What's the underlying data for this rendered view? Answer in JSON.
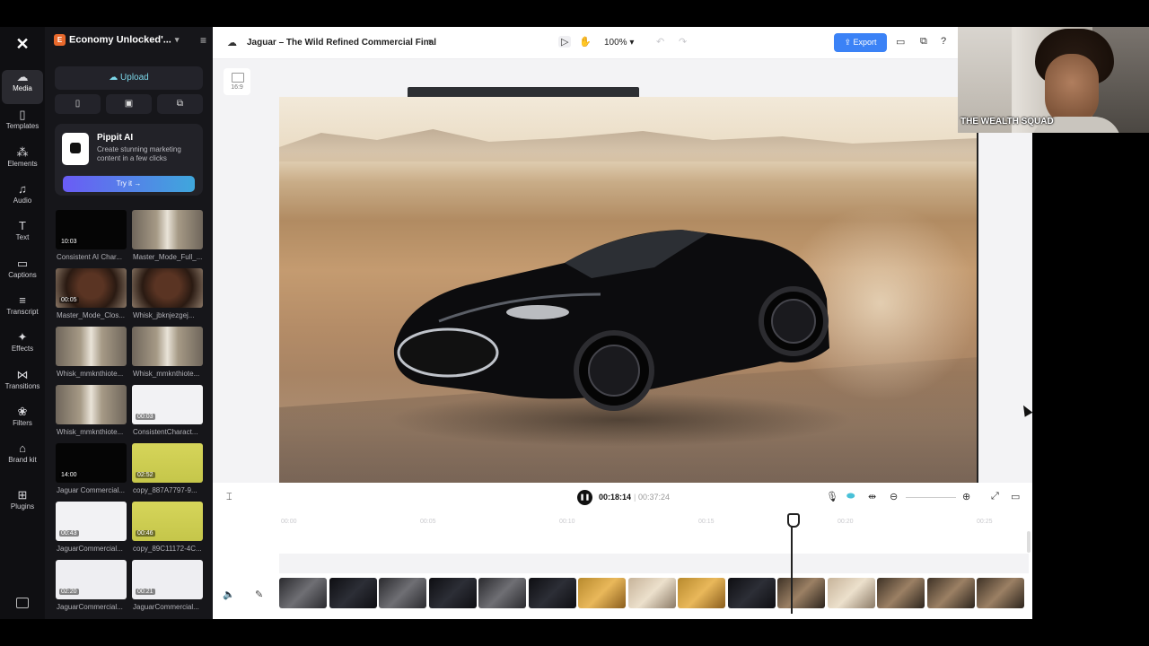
{
  "rail": {
    "items": [
      {
        "label": "Media",
        "icon": "media-icon",
        "glyph": "☁"
      },
      {
        "label": "Templates",
        "icon": "templates-icon",
        "glyph": "▯"
      },
      {
        "label": "Elements",
        "icon": "elements-icon",
        "glyph": "⁂"
      },
      {
        "label": "Audio",
        "icon": "audio-icon",
        "glyph": "♫"
      },
      {
        "label": "Text",
        "icon": "text-icon",
        "glyph": "T"
      },
      {
        "label": "Captions",
        "icon": "captions-icon",
        "glyph": "▭"
      },
      {
        "label": "Transcript",
        "icon": "transcript-icon",
        "glyph": "≡"
      },
      {
        "label": "Effects",
        "icon": "effects-icon",
        "glyph": "✦"
      },
      {
        "label": "Transitions",
        "icon": "transitions-icon",
        "glyph": "⋈"
      },
      {
        "label": "Filters",
        "icon": "filters-icon",
        "glyph": "❀"
      },
      {
        "label": "Brand kit",
        "icon": "brand-kit-icon",
        "glyph": "⌂"
      },
      {
        "label": "Plugins",
        "icon": "plugins-icon",
        "glyph": "⊞"
      }
    ]
  },
  "panel": {
    "project_badge": "E",
    "project_name": "Economy Unlocked'...",
    "upload_label": "Upload",
    "promo": {
      "title": "Pippit AI",
      "text": "Create stunning marketing content in a few clicks",
      "button": "Try it →"
    },
    "media": [
      {
        "caption": "Consistent AI Char...",
        "duration": "10:03",
        "style": "t-black"
      },
      {
        "caption": "Master_Mode_Full_...",
        "duration": "",
        "style": "t-girl"
      },
      {
        "caption": "Master_Mode_Clos...",
        "duration": "00:05",
        "style": "t-face"
      },
      {
        "caption": "Whisk_jbknjezgej...",
        "duration": "",
        "style": "t-face"
      },
      {
        "caption": "Whisk_mmknthiote...",
        "duration": "",
        "style": "t-girl"
      },
      {
        "caption": "Whisk_mmknthiote...",
        "duration": "",
        "style": "t-girl"
      },
      {
        "caption": "Whisk_mmknthiote...",
        "duration": "",
        "style": "t-girl"
      },
      {
        "caption": "ConsistentCharact...",
        "duration": "00:03",
        "style": "t-white"
      },
      {
        "caption": "Jaguar Commercial...",
        "duration": "14:00",
        "style": "t-black"
      },
      {
        "caption": "copy_887A7797-9...",
        "duration": "02:52",
        "style": "t-yellow"
      },
      {
        "caption": "JaguarCommercial...",
        "duration": "00:43",
        "style": "t-white"
      },
      {
        "caption": "copy_89C11172-4C...",
        "duration": "00:46",
        "style": "t-yellow"
      },
      {
        "caption": "JaguarCommercial...",
        "duration": "02:20",
        "style": "t-doc"
      },
      {
        "caption": "JaguarCommercial...",
        "duration": "00:21",
        "style": "t-doc"
      }
    ]
  },
  "topbar": {
    "title": "Jaguar – The Wild Refined Commercial Final",
    "zoom": "100%",
    "export_label": "Export"
  },
  "canvas": {
    "ratio_label": "16:9"
  },
  "playback": {
    "current": "00:18:14",
    "separator": "|",
    "total": "00:37:24"
  },
  "timeline": {
    "ruler": [
      "00:00",
      "00:05",
      "00:10",
      "00:15",
      "00:20",
      "00:25"
    ],
    "clips": [
      "cl-lion",
      "cl-car",
      "cl-lion",
      "cl-car",
      "cl-lion",
      "cl-car",
      "cl-gold",
      "cl-tan",
      "cl-gold",
      "cl-car",
      "cl-beast",
      "cl-tan",
      "cl-beast",
      "cl-beast",
      "cl-beast"
    ]
  },
  "webcam": {
    "label": "THE WEALTH SQUAD"
  }
}
